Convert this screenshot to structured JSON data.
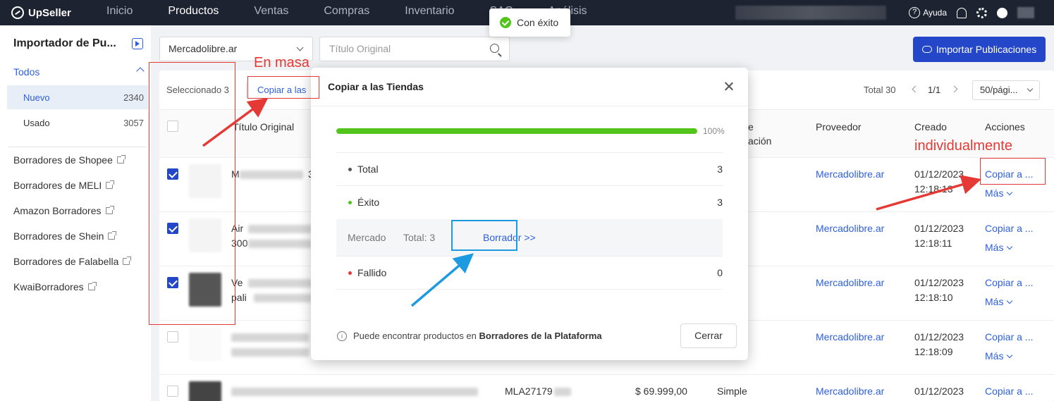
{
  "nav": {
    "brand": "UpSeller",
    "items": [
      "Inicio",
      "Productos",
      "Ventas",
      "Compras",
      "Inventario",
      "SAC",
      "Análisis"
    ],
    "active_index": 1,
    "help_label": "Ayuda"
  },
  "toast": {
    "message": "Con éxito"
  },
  "sidebar": {
    "title": "Importador de Pu...",
    "group_label": "Todos",
    "items": [
      {
        "label": "Nuevo",
        "count": "2340"
      },
      {
        "label": "Usado",
        "count": "3057"
      }
    ],
    "links": [
      "Borradores de Shopee",
      "Borradores de MELI",
      "Amazon Borradores",
      "Borradores de Shein",
      "Borradores de Falabella",
      "KwaiBorradores"
    ]
  },
  "filters": {
    "marketplace_value": "Mercadolibre.ar",
    "search_placeholder": "Título Original",
    "import_button": "Importar Publicaciones"
  },
  "toolbar": {
    "selected_text": "Seleccionado 3",
    "bulk_copy": "Copiar a las",
    "total": "Total 30",
    "page": "1/1",
    "page_size": "50/pági..."
  },
  "table": {
    "headers": {
      "title": "Título Original",
      "publication_partial": "e",
      "publication_partial2": "ación",
      "provider": "Proveedor",
      "created": "Creado",
      "actions": "Acciones"
    },
    "rows": [
      {
        "title_partial": "M",
        "title_tail": "3",
        "provider": "Mercadolibre.ar",
        "date": "01/12/2023",
        "time": "12:18:13",
        "action": "Copiar a ...",
        "more": "Más",
        "checked": true
      },
      {
        "title_partial": "Air",
        "title_line2": "300",
        "provider": "Mercadolibre.ar",
        "date": "01/12/2023",
        "time": "12:18:11",
        "action": "Copiar a ...",
        "more": "Más",
        "checked": true
      },
      {
        "title_partial": "Ve",
        "title_line2": "pali",
        "provider": "Mercadolibre.ar",
        "date": "01/12/2023",
        "time": "12:18:10",
        "action": "Copiar a ...",
        "more": "Más",
        "checked": true
      },
      {
        "title_partial": "",
        "provider": "Mercadolibre.ar",
        "date": "01/12/2023",
        "time": "12:18:09",
        "action": "Copiar a ...",
        "more": "Más",
        "checked": false
      },
      {
        "title_partial": "",
        "sku": "MLA27179",
        "price": "$ 69.999,00",
        "type": "Simple",
        "provider": "Mercadolibre.ar",
        "date": "01/12/2023",
        "action": "Copiar a ...",
        "checked": false
      }
    ]
  },
  "modal": {
    "title": "Copiar a las Tiendas",
    "progress": 100,
    "progress_label": "100%",
    "total_label": "Total",
    "total_value": "3",
    "success_label": "Éxito",
    "success_value": "3",
    "market_label": "Mercado",
    "market_total": "Total: 3",
    "draft_link": "Borrador >>",
    "failed_label": "Fallido",
    "failed_value": "0",
    "info_prefix": "Puede encontrar productos en",
    "info_bold": "Borradores de la Plataforma",
    "close_button": "Cerrar"
  },
  "annotations": {
    "bulk": "En masa",
    "individual": "individualmente"
  },
  "colors": {
    "primary": "#2347c8",
    "link": "#2d5fdc",
    "success": "#52c41a",
    "danger": "#e53935",
    "annotation_blue": "#1e9be0",
    "nav_bg": "#1d2330"
  }
}
